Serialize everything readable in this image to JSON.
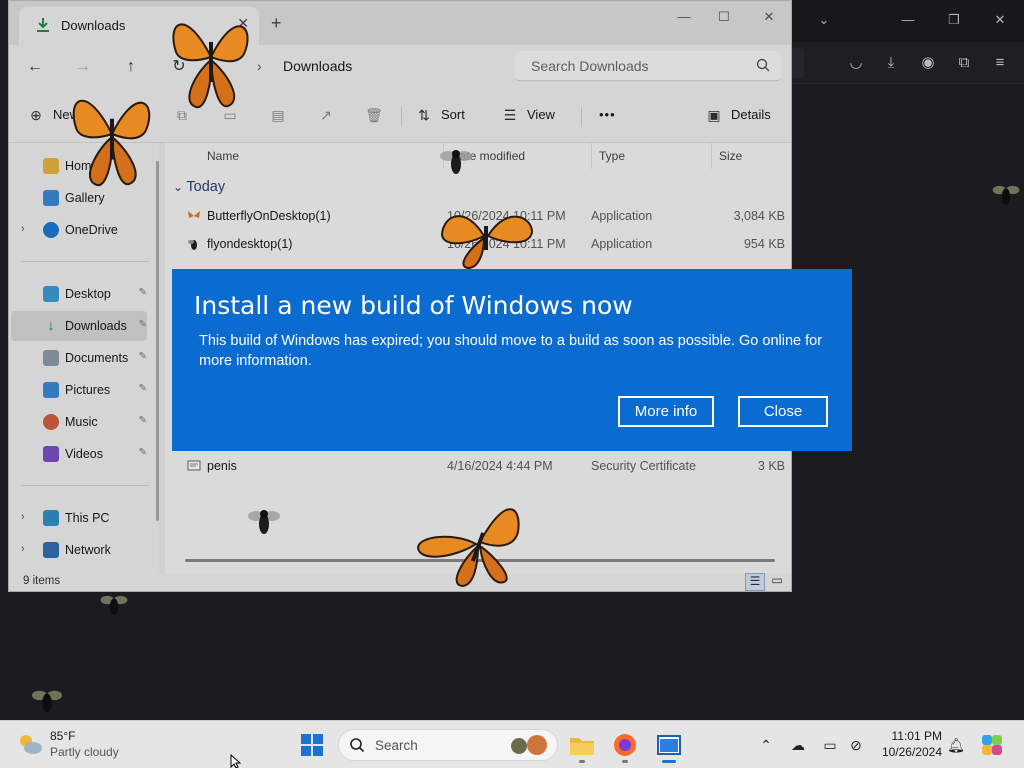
{
  "explorer": {
    "tab_title": "Downloads",
    "address": "Downloads",
    "search_placeholder": "Search Downloads",
    "commands": {
      "new_label": "New",
      "sort_label": "Sort",
      "view_label": "View",
      "more_label": "•••",
      "details_label": "Details"
    },
    "sidebar": {
      "items": [
        {
          "label": "Home"
        },
        {
          "label": "Gallery"
        },
        {
          "label": "OneDrive"
        },
        {
          "label": "Desktop"
        },
        {
          "label": "Downloads"
        },
        {
          "label": "Documents"
        },
        {
          "label": "Pictures"
        },
        {
          "label": "Music"
        },
        {
          "label": "Videos"
        },
        {
          "label": "This PC"
        },
        {
          "label": "Network"
        }
      ]
    },
    "columns": {
      "name": "Name",
      "date": "Date modified",
      "type": "Type",
      "size": "Size"
    },
    "group_label": "Today",
    "files": [
      {
        "name": "ButterflyOnDesktop(1)",
        "date": "10/26/2024 10:11 PM",
        "type": "Application",
        "size": "3,084 KB"
      },
      {
        "name": "flyondesktop(1)",
        "date": "10/26/2024 10:11 PM",
        "type": "Application",
        "size": "954 KB"
      },
      {
        "name": "penis",
        "date": "4/16/2024 4:44 PM",
        "type": "Security Certificate",
        "size": "3 KB"
      }
    ],
    "status": "9 items"
  },
  "dialog": {
    "title": "Install a new build of Windows now",
    "body": "This build of Windows has expired; you should move to a build as soon as possible. Go online for more information.",
    "more_info_label": "More info",
    "close_label": "Close"
  },
  "taskbar": {
    "weather_temp": "85°F",
    "weather_desc": "Partly cloudy",
    "search_label": "Search",
    "time": "11:01 PM",
    "date": "10/26/2024"
  },
  "colors": {
    "dialog_bg": "#0a6bd0",
    "taskbar_bg": "#e5e5e5",
    "explorer_bg": "#e9e9e9"
  }
}
